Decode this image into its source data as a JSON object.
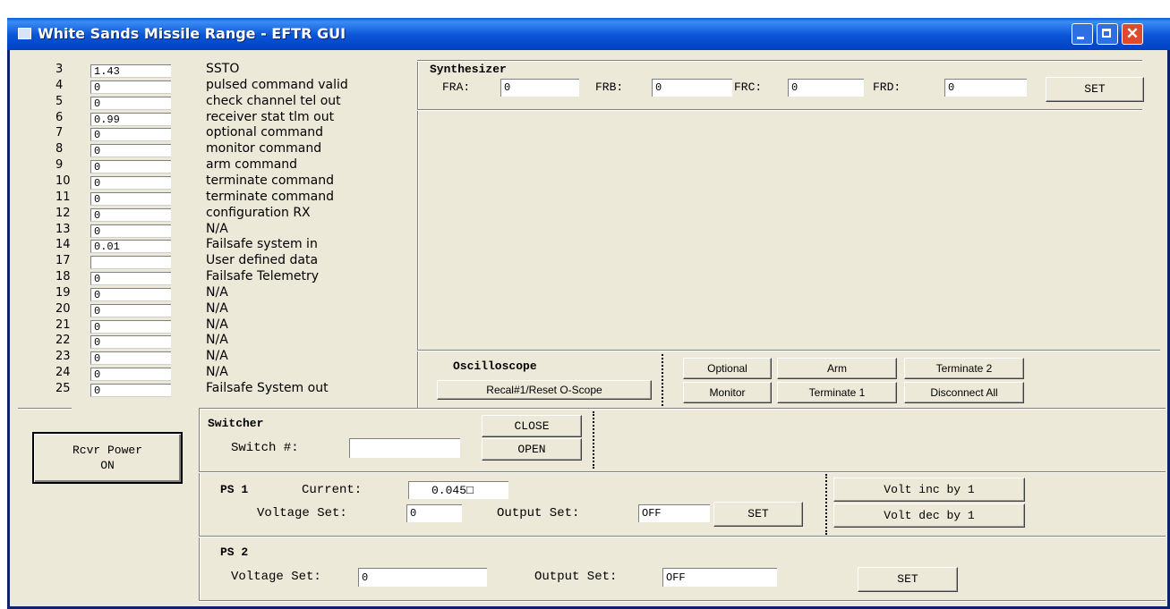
{
  "window": {
    "title": "White Sands Missile Range - EFTR GUI"
  },
  "channels": [
    {
      "num": "3",
      "value": "1.43",
      "label": "SSTO"
    },
    {
      "num": "4",
      "value": "0",
      "label": "pulsed command valid"
    },
    {
      "num": "5",
      "value": "0",
      "label": "check channel tel out"
    },
    {
      "num": "6",
      "value": "0.99",
      "label": "receiver stat tlm out"
    },
    {
      "num": "7",
      "value": "0",
      "label": "optional command"
    },
    {
      "num": "8",
      "value": "0",
      "label": "monitor command"
    },
    {
      "num": "9",
      "value": "0",
      "label": "arm command"
    },
    {
      "num": "10",
      "value": "0",
      "label": "terminate command"
    },
    {
      "num": "11",
      "value": "0",
      "label": "terminate command"
    },
    {
      "num": "12",
      "value": "0",
      "label": "configuration RX"
    },
    {
      "num": "13",
      "value": "0",
      "label": "N/A"
    },
    {
      "num": "14",
      "value": "0.01",
      "label": "Failsafe system in"
    },
    {
      "num": "17",
      "value": "",
      "label": "User defined data"
    },
    {
      "num": "18",
      "value": "0",
      "label": "Failsafe Telemetry"
    },
    {
      "num": "19",
      "value": "0",
      "label": "N/A"
    },
    {
      "num": "20",
      "value": "0",
      "label": "N/A"
    },
    {
      "num": "21",
      "value": "0",
      "label": "N/A"
    },
    {
      "num": "22",
      "value": "0",
      "label": "N/A"
    },
    {
      "num": "23",
      "value": "0",
      "label": "N/A"
    },
    {
      "num": "24",
      "value": "0",
      "label": "N/A"
    },
    {
      "num": "25",
      "value": "0",
      "label": "Failsafe System out"
    }
  ],
  "synthesizer": {
    "title": "Synthesizer",
    "fra_label": "FRA:",
    "fra_value": "0",
    "frb_label": "FRB:",
    "frb_value": "0",
    "frc_label": "FRC:",
    "frc_value": "0",
    "frd_label": "FRD:",
    "frd_value": "0",
    "set_label": "SET"
  },
  "oscilloscope": {
    "title": "Oscilloscope",
    "recal_label": "Recal#1/Reset O-Scope",
    "optional_label": "Optional",
    "arm_label": "Arm",
    "terminate2_label": "Terminate 2",
    "monitor_label": "Monitor",
    "terminate1_label": "Terminate 1",
    "disconnect_label": "Disconnect All"
  },
  "rcvr_power": {
    "line1": "Rcvr Power",
    "line2": "ON"
  },
  "switcher": {
    "title": "Switcher",
    "switch_label": "Switch #:",
    "switch_value": "",
    "close_label": "CLOSE",
    "open_label": "OPEN"
  },
  "ps1": {
    "title": "PS 1",
    "current_label": "Current:",
    "current_value": "0.045□",
    "voltage_label": "Voltage Set:",
    "voltage_value": "0",
    "output_label": "Output Set:",
    "output_value": "OFF",
    "set_label": "SET",
    "volt_inc_label": "Volt inc by 1",
    "volt_dec_label": "Volt dec by 1"
  },
  "ps2": {
    "title": "PS 2",
    "voltage_label": "Voltage Set:",
    "voltage_value": "0",
    "output_label": "Output Set:",
    "output_value": "OFF",
    "set_label": "SET"
  }
}
